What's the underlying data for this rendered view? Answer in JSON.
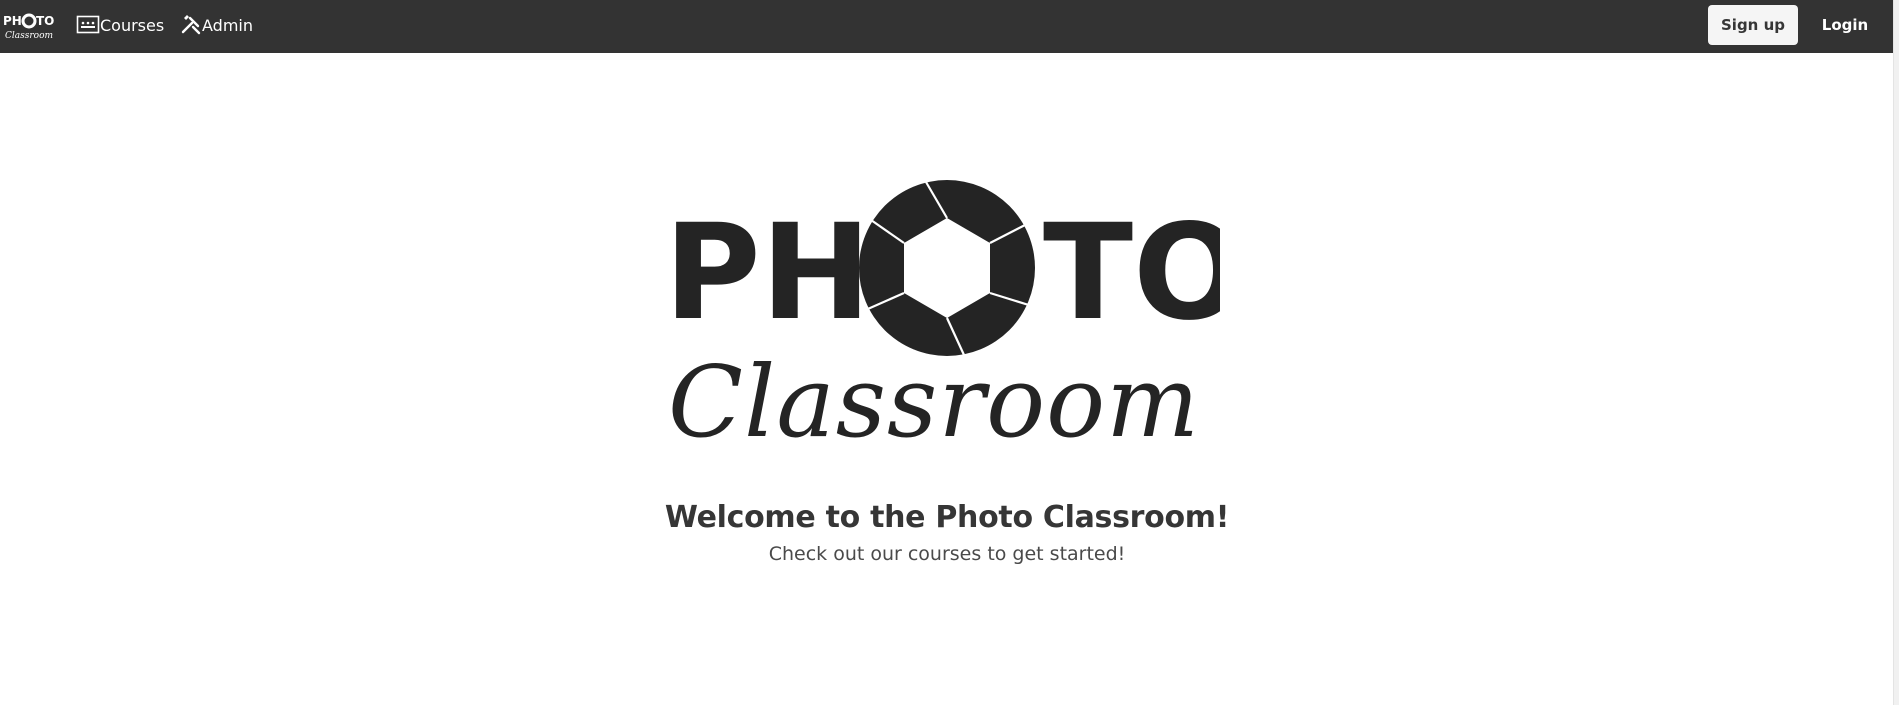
{
  "nav": {
    "brand_line1": "PHOTO",
    "brand_line2": "Classroom",
    "courses_label": "Courses",
    "courses_icon": "image-icon",
    "admin_label": "Admin",
    "admin_icon": "tools-icon",
    "signup_label": "Sign up",
    "login_label": "Login"
  },
  "hero": {
    "logo_word_left": "PH",
    "logo_word_right": "TO",
    "logo_script": "Classroom",
    "logo_icon": "camera-aperture-icon",
    "title": "Welcome to the Photo Classroom!",
    "subtitle": "Check out our courses to get started!"
  },
  "colors": {
    "topbar": "#333333",
    "logo": "#242424",
    "title_text": "#363636",
    "button_light": "#f5f5f5"
  }
}
